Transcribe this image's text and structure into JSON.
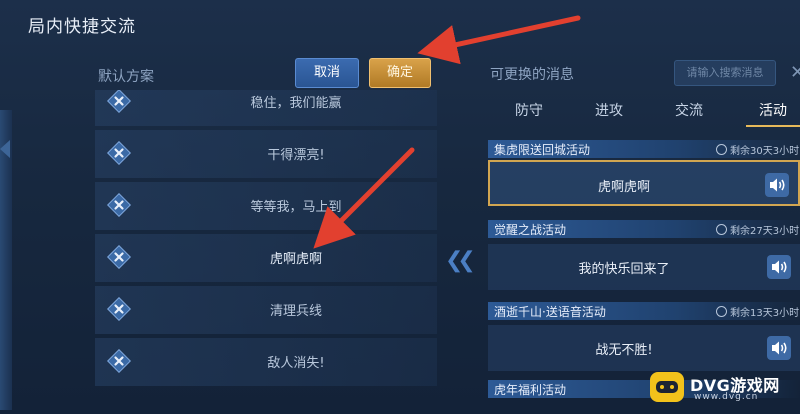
{
  "window": {
    "title": "局内快捷交流"
  },
  "left_panel": {
    "label": "默认方案",
    "cancel_label": "取消",
    "confirm_label": "确定",
    "rows": [
      {
        "text": "稳住，我们能赢"
      },
      {
        "text": "干得漂亮!"
      },
      {
        "text": "等等我，马上到"
      },
      {
        "text": "虎啊虎啊"
      },
      {
        "text": "清理兵线"
      },
      {
        "text": "敌人消失!"
      }
    ]
  },
  "right_panel": {
    "label": "可更换的消息",
    "search_placeholder": "请输入搜索消息",
    "tabs": [
      {
        "label": "防守"
      },
      {
        "label": "进攻"
      },
      {
        "label": "交流"
      },
      {
        "label": "活动",
        "active": true
      }
    ],
    "sections": [
      {
        "name": "集虎限送回城活动",
        "time": "剩余30天3小时",
        "message": "虎啊虎啊",
        "selected": true
      },
      {
        "name": "觉醒之战活动",
        "time": "剩余27天3小时",
        "message": "我的快乐回来了"
      },
      {
        "name": "酒逝千山·送语音活动",
        "time": "剩余13天3小时",
        "message": "战无不胜!"
      },
      {
        "name": "虎年福利活动",
        "time": "",
        "message": ""
      }
    ]
  },
  "watermark": {
    "brand": "DVG游戏网",
    "url": "www.dvg.cn"
  },
  "colors": {
    "accent_gold": "#d2a651",
    "arrow_red": "#e2402f",
    "panel_blue": "#2d5a96"
  }
}
